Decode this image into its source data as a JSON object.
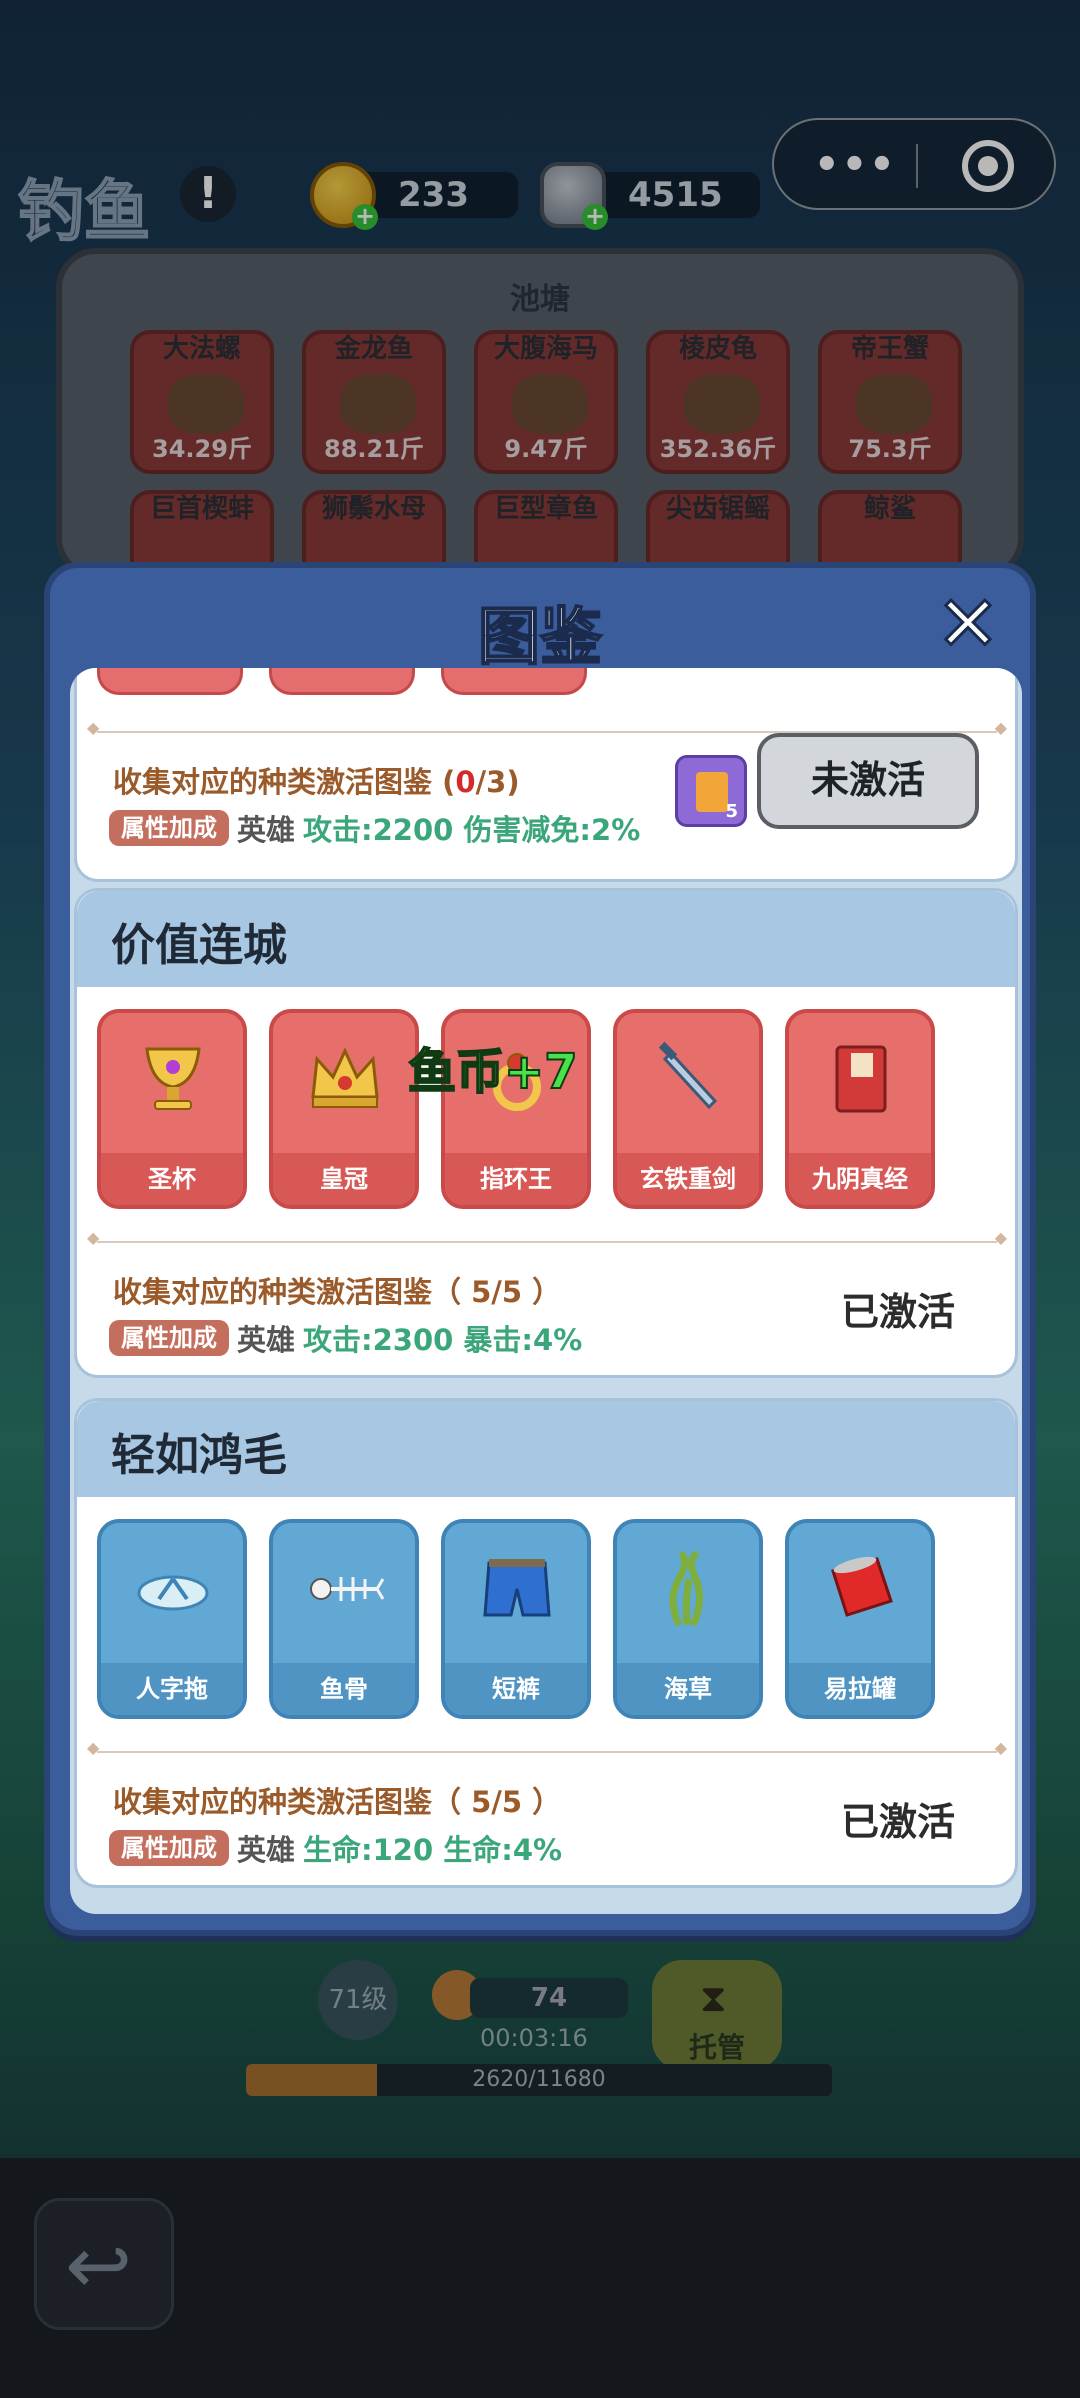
{
  "header": {
    "title": "钓鱼",
    "info_icon": "!",
    "currency": [
      {
        "icon": "coin-icon",
        "value": "233"
      },
      {
        "icon": "ore-icon",
        "value": "4515"
      }
    ]
  },
  "capsule": {
    "more": "•••"
  },
  "pond": {
    "title": "池塘",
    "fish": [
      {
        "name": "大法螺",
        "weight": "34.29斤"
      },
      {
        "name": "金龙鱼",
        "weight": "88.21斤"
      },
      {
        "name": "大腹海马",
        "weight": "9.47斤"
      },
      {
        "name": "棱皮龟",
        "weight": "352.36斤"
      },
      {
        "name": "帝王蟹",
        "weight": "75.3斤"
      },
      {
        "name": "巨首楔蚌",
        "weight": ""
      },
      {
        "name": "狮鬃水母",
        "weight": ""
      },
      {
        "name": "巨型章鱼",
        "weight": ""
      },
      {
        "name": "尖齿锯鳐",
        "weight": ""
      },
      {
        "name": "鲸鲨",
        "weight": ""
      }
    ]
  },
  "modal": {
    "title": "图鉴",
    "close_icon": "✕",
    "partial_set": {
      "collect_prefix": "收集对应的种类激活图鉴 (",
      "collect_count": "0",
      "collect_suffix": "/3)",
      "bonus_tag": "属性加成",
      "bonus_hero": "英雄",
      "bonus_stats": "攻击:2200 伤害减免:2%",
      "scroll_count": "5",
      "button_label": "未激活"
    },
    "sets": [
      {
        "name": "价值连城",
        "items": [
          "圣杯",
          "皇冠",
          "指环王",
          "玄铁重剑",
          "九阴真经"
        ],
        "collect": "收集对应的种类激活图鉴（ 5/5 ）",
        "bonus_tag": "属性加成",
        "bonus_hero": "英雄",
        "bonus_stats": "攻击:2300 暴击:4%",
        "status": "已激活"
      },
      {
        "name": "轻如鸿毛",
        "items": [
          "人字拖",
          "鱼骨",
          "短裤",
          "海草",
          "易拉罐"
        ],
        "collect": "收集对应的种类激活图鉴（ 5/5 ）",
        "bonus_tag": "属性加成",
        "bonus_hero": "英雄",
        "bonus_stats": "生命:120 生命:4%",
        "status": "已激活"
      }
    ]
  },
  "float_text": "鱼币+7",
  "bottom": {
    "level": "71级",
    "bait_count": "74",
    "timer": "00:03:16",
    "auto_label": "托管",
    "xp_text": "2620/11680",
    "xp_fraction": 0.224
  },
  "colors": {
    "accent_green": "#3aa67a",
    "set_red": "#e66f6c",
    "set_blue": "#62a8d4",
    "modal_blue": "#3b5d9c"
  }
}
